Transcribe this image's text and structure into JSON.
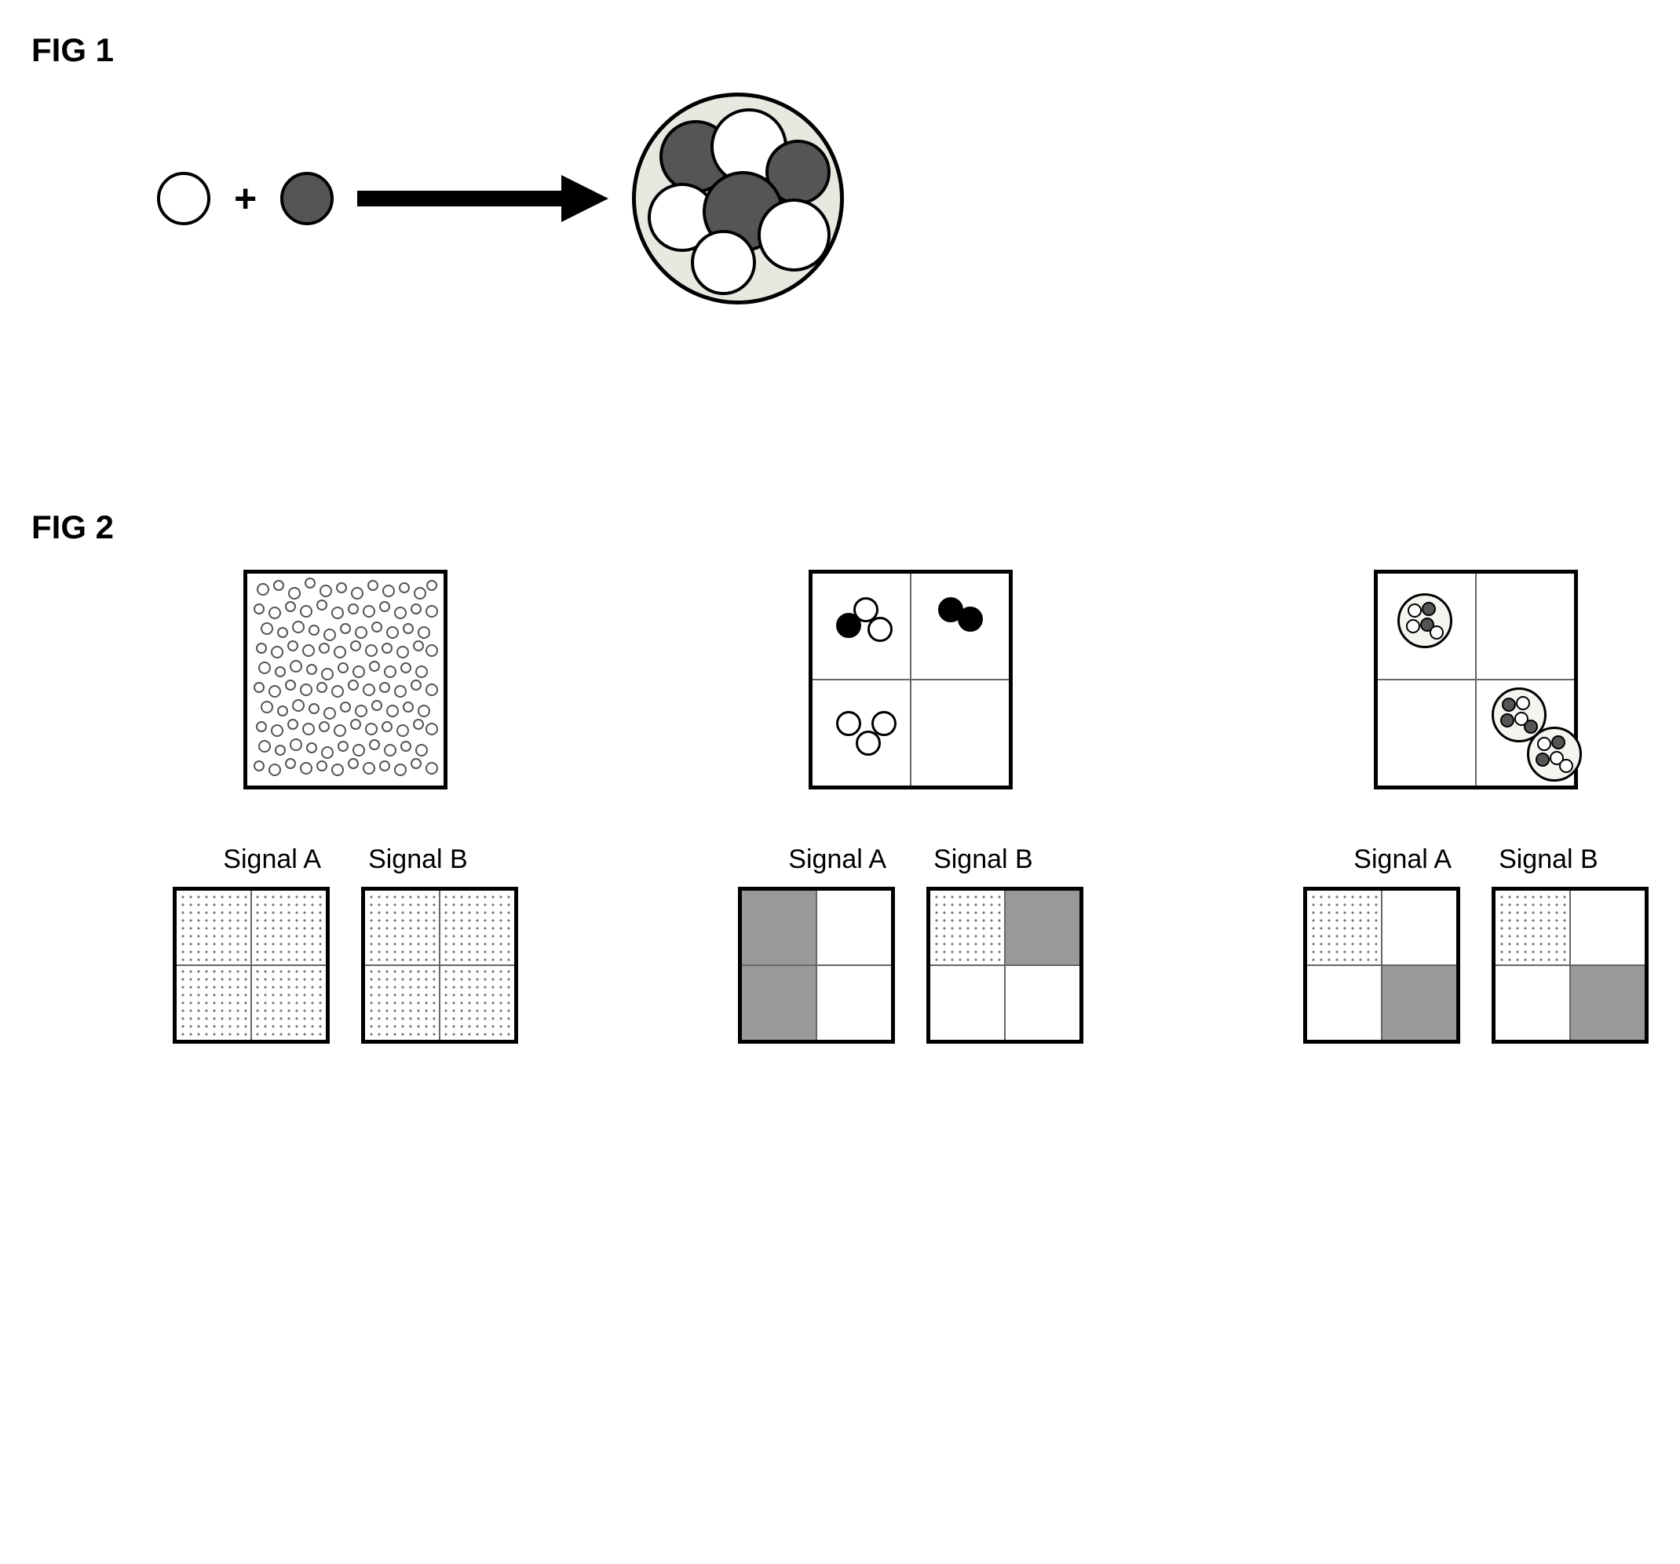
{
  "fig1": {
    "label": "FIG 1",
    "plus": "+"
  },
  "fig2": {
    "label": "FIG 2",
    "columns": [
      {
        "signalA": "Signal A",
        "signalB": "Signal B"
      },
      {
        "signalA": "Signal A",
        "signalB": "Signal B"
      },
      {
        "signalA": "Signal A",
        "signalB": "Signal B"
      }
    ]
  }
}
